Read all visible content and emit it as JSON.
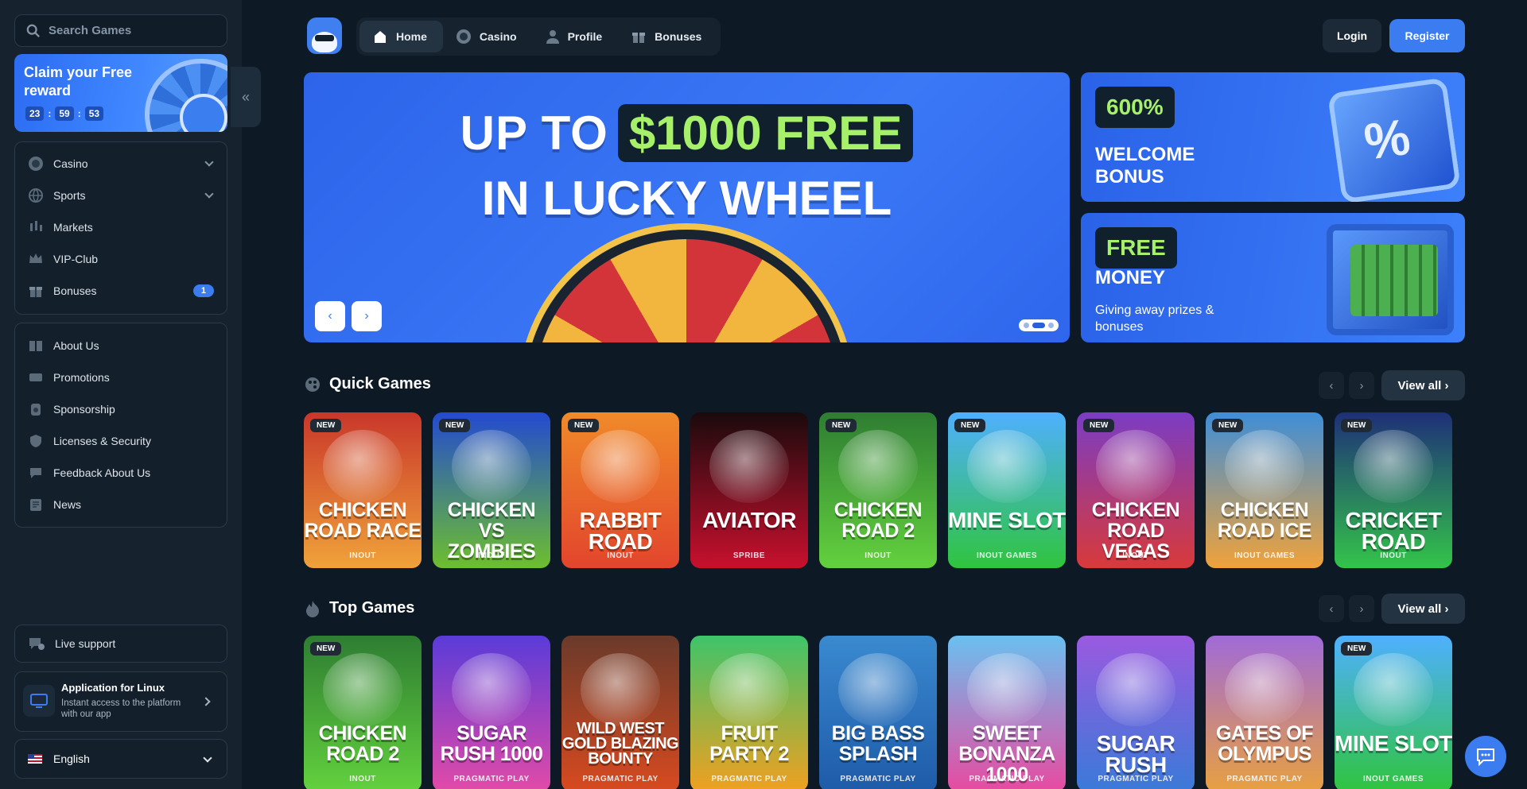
{
  "sidebar": {
    "search_placeholder": "Search Games",
    "reward": {
      "title": "Claim your Free reward",
      "timer": [
        "23",
        "59",
        "53"
      ]
    },
    "menu1": [
      {
        "label": "Casino",
        "icon": "casino-chip-icon",
        "expandable": true
      },
      {
        "label": "Sports",
        "icon": "globe-icon",
        "expandable": true
      },
      {
        "label": "Markets",
        "icon": "candles-icon"
      },
      {
        "label": "VIP-Club",
        "icon": "crown-icon"
      },
      {
        "label": "Bonuses",
        "icon": "gift-icon",
        "badge": "1"
      }
    ],
    "menu2": [
      {
        "label": "About Us",
        "icon": "book-icon"
      },
      {
        "label": "Promotions",
        "icon": "tickets-icon"
      },
      {
        "label": "Sponsorship",
        "icon": "medal-icon"
      },
      {
        "label": "Licenses & Security",
        "icon": "shield-icon"
      },
      {
        "label": "Feedback About Us",
        "icon": "chat-bubble-icon"
      },
      {
        "label": "News",
        "icon": "newspaper-icon"
      }
    ],
    "support_label": "Live support",
    "app": {
      "title": "Application for Linux",
      "desc": "Instant access to the platform with our app"
    },
    "language": "English"
  },
  "header": {
    "tabs": [
      {
        "label": "Home",
        "active": true
      },
      {
        "label": "Casino"
      },
      {
        "label": "Profile"
      },
      {
        "label": "Bonuses"
      }
    ],
    "login": "Login",
    "register": "Register"
  },
  "hero": {
    "line1_a": "UP TO",
    "line1_b": "$1000 FREE",
    "line2": "IN LUCKY WHEEL",
    "slide_count": 3,
    "active_slide": 2
  },
  "promos": [
    {
      "tag": "600%",
      "title": "WELCOME BONUS"
    },
    {
      "tag": "FREE",
      "title": "MONEY",
      "subtitle": "Giving away prizes & bonuses"
    }
  ],
  "quick_games": {
    "title": "Quick Games",
    "view_all": "View all",
    "cards": [
      {
        "name": "CHICKEN ROAD RACE",
        "provider": "INOUT",
        "new": true,
        "bg": [
          "#c9372a",
          "#f0a23a"
        ]
      },
      {
        "name": "CHICKEN VS ZOMBIES",
        "provider": "INOUT",
        "new": true,
        "bg": [
          "#234ad0",
          "#6dbf2e"
        ]
      },
      {
        "name": "RABBIT ROAD",
        "provider": "INOUT",
        "new": true,
        "bg": [
          "#f08a2a",
          "#e2452c"
        ]
      },
      {
        "name": "AVIATOR",
        "provider": "SPRIBE",
        "new": false,
        "bg": [
          "#1a0a0c",
          "#c8102e"
        ]
      },
      {
        "name": "CHICKEN ROAD 2",
        "provider": "INOUT",
        "new": true,
        "bg": [
          "#2e7d32",
          "#63d13e"
        ]
      },
      {
        "name": "MINE SLOT",
        "provider": "INOUT GAMES",
        "new": true,
        "bg": [
          "#4fb0ff",
          "#2fc43e"
        ]
      },
      {
        "name": "CHICKEN ROAD VEGAS",
        "provider": "INOUT",
        "new": true,
        "bg": [
          "#7b3cc4",
          "#d83a3a"
        ]
      },
      {
        "name": "CHICKEN ROAD ICE",
        "provider": "INOUT GAMES",
        "new": true,
        "bg": [
          "#3e8ed8",
          "#f0a23a"
        ]
      },
      {
        "name": "CRICKET ROAD",
        "provider": "INOUT",
        "new": true,
        "bg": [
          "#1e2f78",
          "#33c44a"
        ]
      }
    ]
  },
  "top_games": {
    "title": "Top Games",
    "view_all": "View all",
    "cards": [
      {
        "name": "CHICKEN ROAD 2",
        "provider": "INOUT",
        "new": true,
        "bg": [
          "#2e7d32",
          "#63d13e"
        ]
      },
      {
        "name": "SUGAR RUSH 1000",
        "provider": "PRAGMATIC PLAY",
        "new": false,
        "bg": [
          "#5a3bd8",
          "#e24aa8"
        ]
      },
      {
        "name": "WILD WEST GOLD BLAZING BOUNTY",
        "provider": "PRAGMATIC PLAY",
        "new": false,
        "bg": [
          "#6a3a2a",
          "#d84a20"
        ]
      },
      {
        "name": "FRUIT PARTY 2",
        "provider": "PRAGMATIC PLAY",
        "new": false,
        "bg": [
          "#3ec46a",
          "#f0a020"
        ]
      },
      {
        "name": "BIG BASS SPLASH",
        "provider": "PRAGMATIC PLAY",
        "new": false,
        "bg": [
          "#3a8ad0",
          "#1e5aa8"
        ]
      },
      {
        "name": "SWEET BONANZA 1000",
        "provider": "PRAGMATIC PLAY",
        "new": false,
        "bg": [
          "#6ac0f0",
          "#e84aa0"
        ]
      },
      {
        "name": "SUGAR RUSH",
        "provider": "PRAGMATIC PLAY",
        "new": false,
        "bg": [
          "#9a5ae0",
          "#3a7ad8"
        ]
      },
      {
        "name": "GATES OF OLYMPUS",
        "provider": "PRAGMATIC PLAY",
        "new": false,
        "bg": [
          "#a06ad8",
          "#e8a040"
        ]
      },
      {
        "name": "MINE SLOT",
        "provider": "INOUT GAMES",
        "new": true,
        "bg": [
          "#4fb0ff",
          "#2fc43e"
        ]
      }
    ]
  },
  "colors": {
    "accent": "#3b7df0",
    "bg": "#0d1924",
    "panel": "#16232f",
    "lime": "#a7f06a"
  }
}
